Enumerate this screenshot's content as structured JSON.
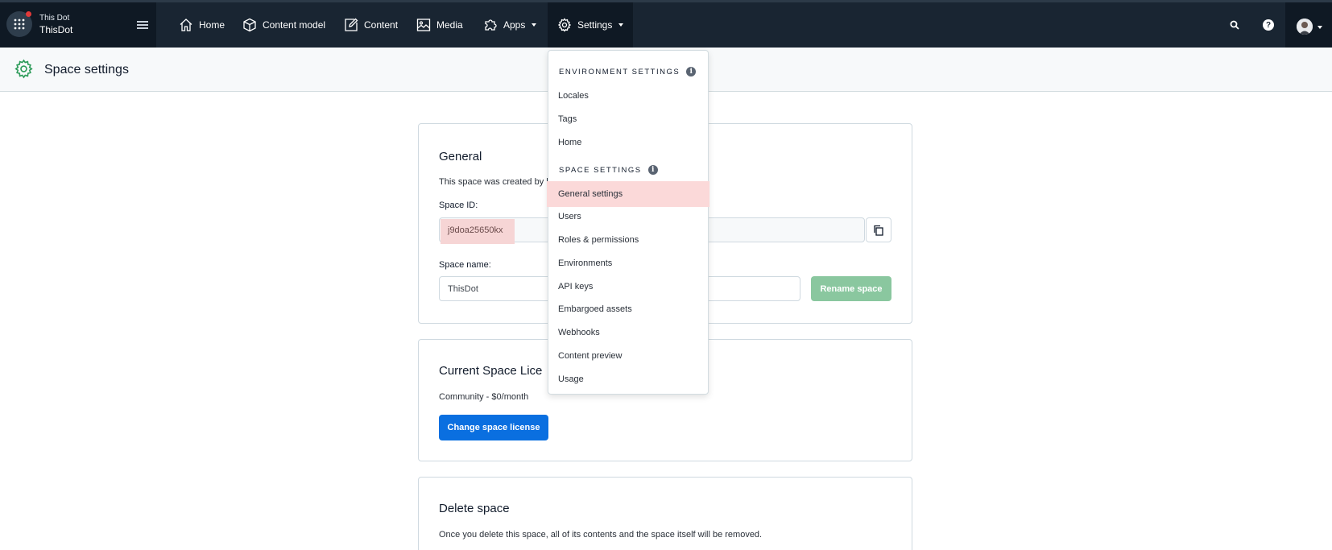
{
  "space": {
    "org": "This Dot",
    "name": "ThisDot"
  },
  "nav": {
    "home": "Home",
    "content_model": "Content model",
    "content": "Content",
    "media": "Media",
    "apps": "Apps",
    "settings": "Settings"
  },
  "header": {
    "title": "Space settings"
  },
  "general": {
    "title": "General",
    "created_text": "This space was created by l",
    "space_id_label": "Space ID:",
    "space_id_value": "j9doa25650kx",
    "space_name_label": "Space name:",
    "space_name_value": "ThisDot",
    "rename_button": "Rename space"
  },
  "license": {
    "title": "Current Space Lice",
    "plan": "Community - $0/month",
    "change_button": "Change space license"
  },
  "delete": {
    "title": "Delete space",
    "text": "Once you delete this space, all of its contents and the space itself will be removed."
  },
  "menu": {
    "environment_section": "ENVIRONMENT SETTINGS",
    "environment_items": [
      "Locales",
      "Tags",
      "Home"
    ],
    "space_section": "SPACE SETTINGS",
    "space_items": [
      "General settings",
      "Users",
      "Roles & permissions",
      "Environments",
      "API keys",
      "Embargoed assets",
      "Webhooks",
      "Content preview",
      "Usage"
    ],
    "info_glyph": "i"
  },
  "icons": {
    "help_glyph": "?"
  },
  "colors": {
    "nav_bg": "#192532",
    "accent_blue": "#0a6fe0",
    "rename_green": "#8ac79f",
    "highlight_pink": "#fbd9d9"
  }
}
